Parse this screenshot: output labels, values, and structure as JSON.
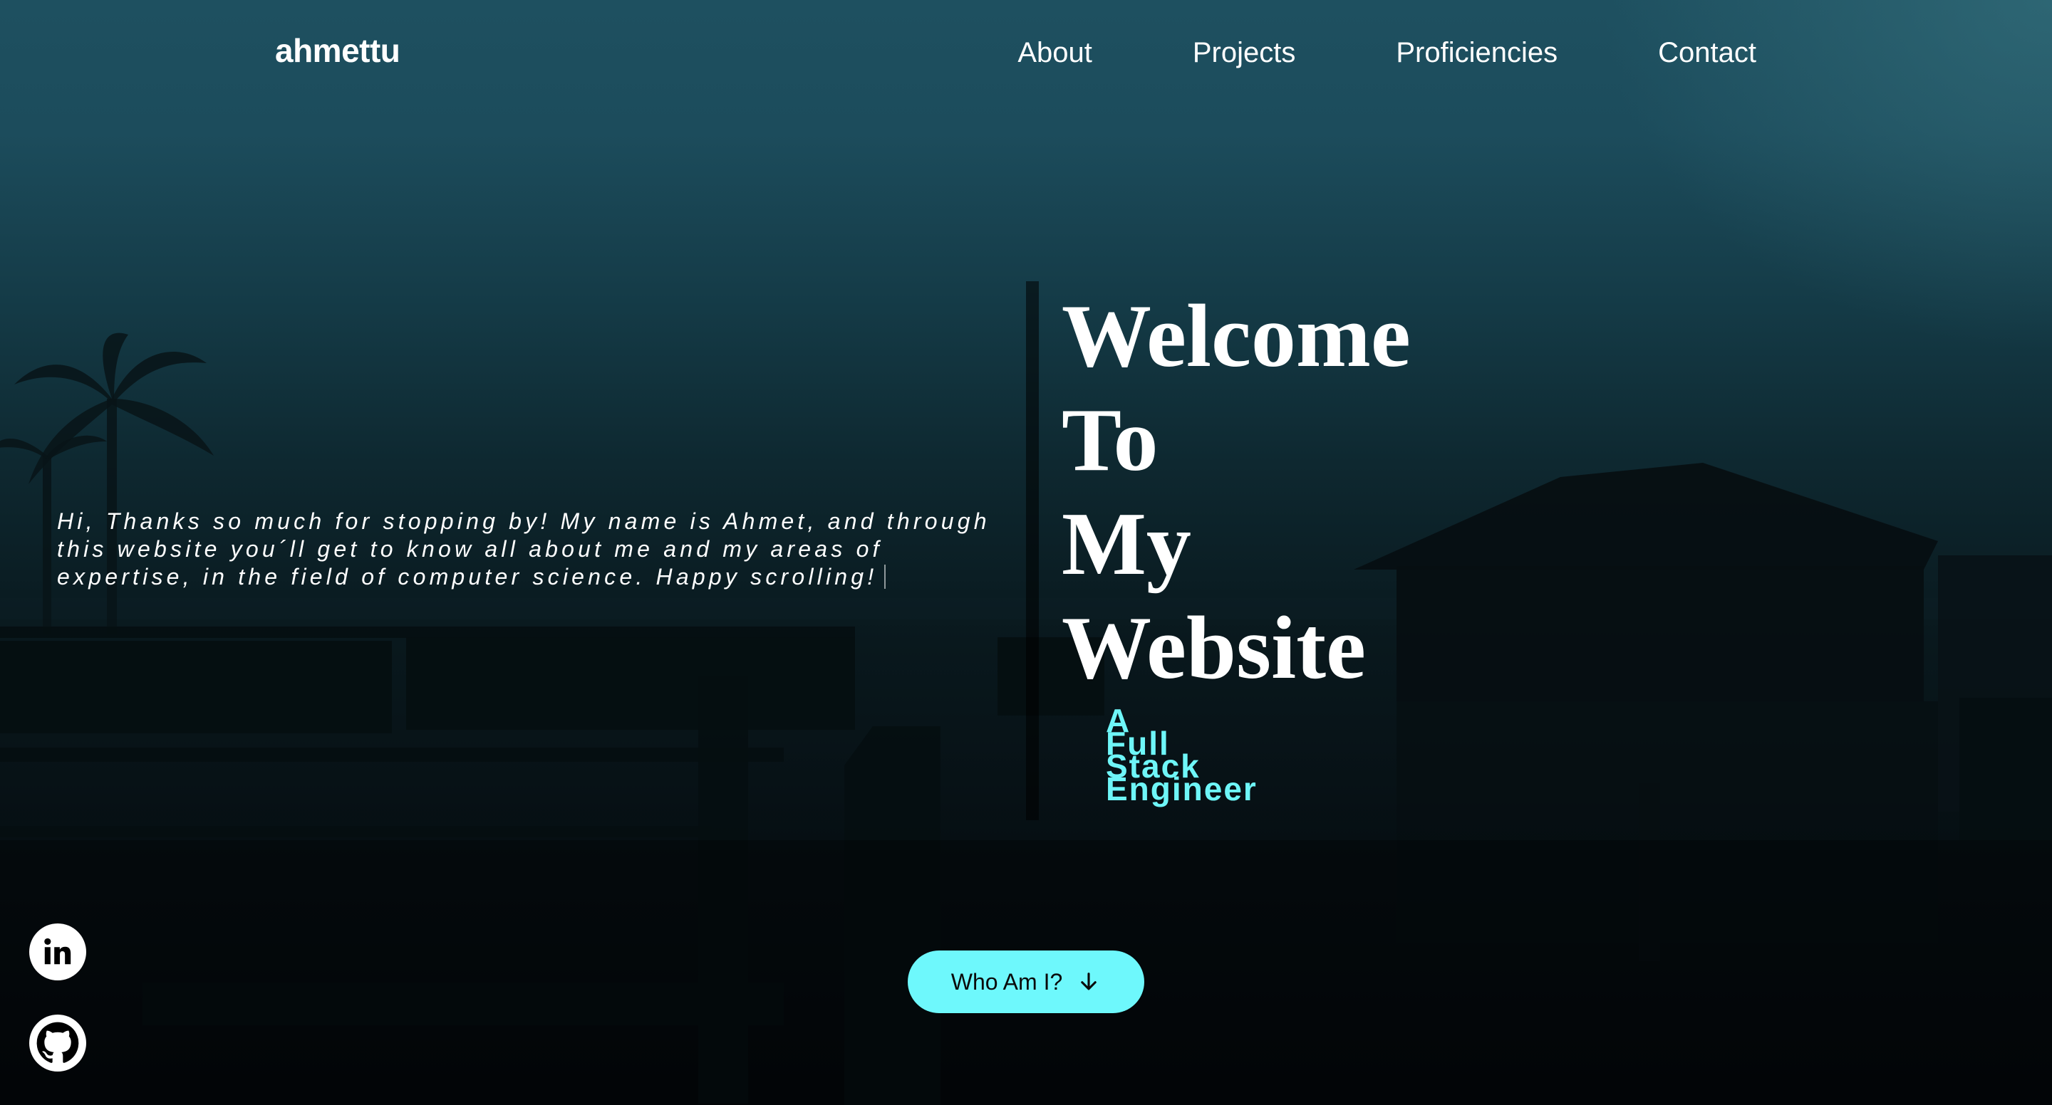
{
  "brand": {
    "logo": "ahmettu"
  },
  "nav": {
    "items": [
      {
        "label": "About"
      },
      {
        "label": "Projects"
      },
      {
        "label": "Proficiencies"
      },
      {
        "label": "Contact"
      }
    ]
  },
  "hero": {
    "intro": "Hi, Thanks so much for stopping by! My name is Ahmet, and through this website you´ll get to know all about me and my areas of expertise, in the field of computer science. Happy scrolling!",
    "headline": [
      "Welcome",
      "To",
      "My",
      "Website"
    ],
    "tagline": [
      "A",
      "Full",
      "Stack",
      "Engineer"
    ]
  },
  "cta": {
    "label": "Who Am I?",
    "icon": "arrow-down-icon"
  },
  "socials": [
    {
      "name": "linkedin",
      "icon": "linkedin-icon"
    },
    {
      "name": "github",
      "icon": "github-icon"
    }
  ],
  "colors": {
    "accent": "#6ef8fc",
    "text": "#ffffff",
    "background_top": "#1e5060",
    "background_bottom": "#030608"
  }
}
